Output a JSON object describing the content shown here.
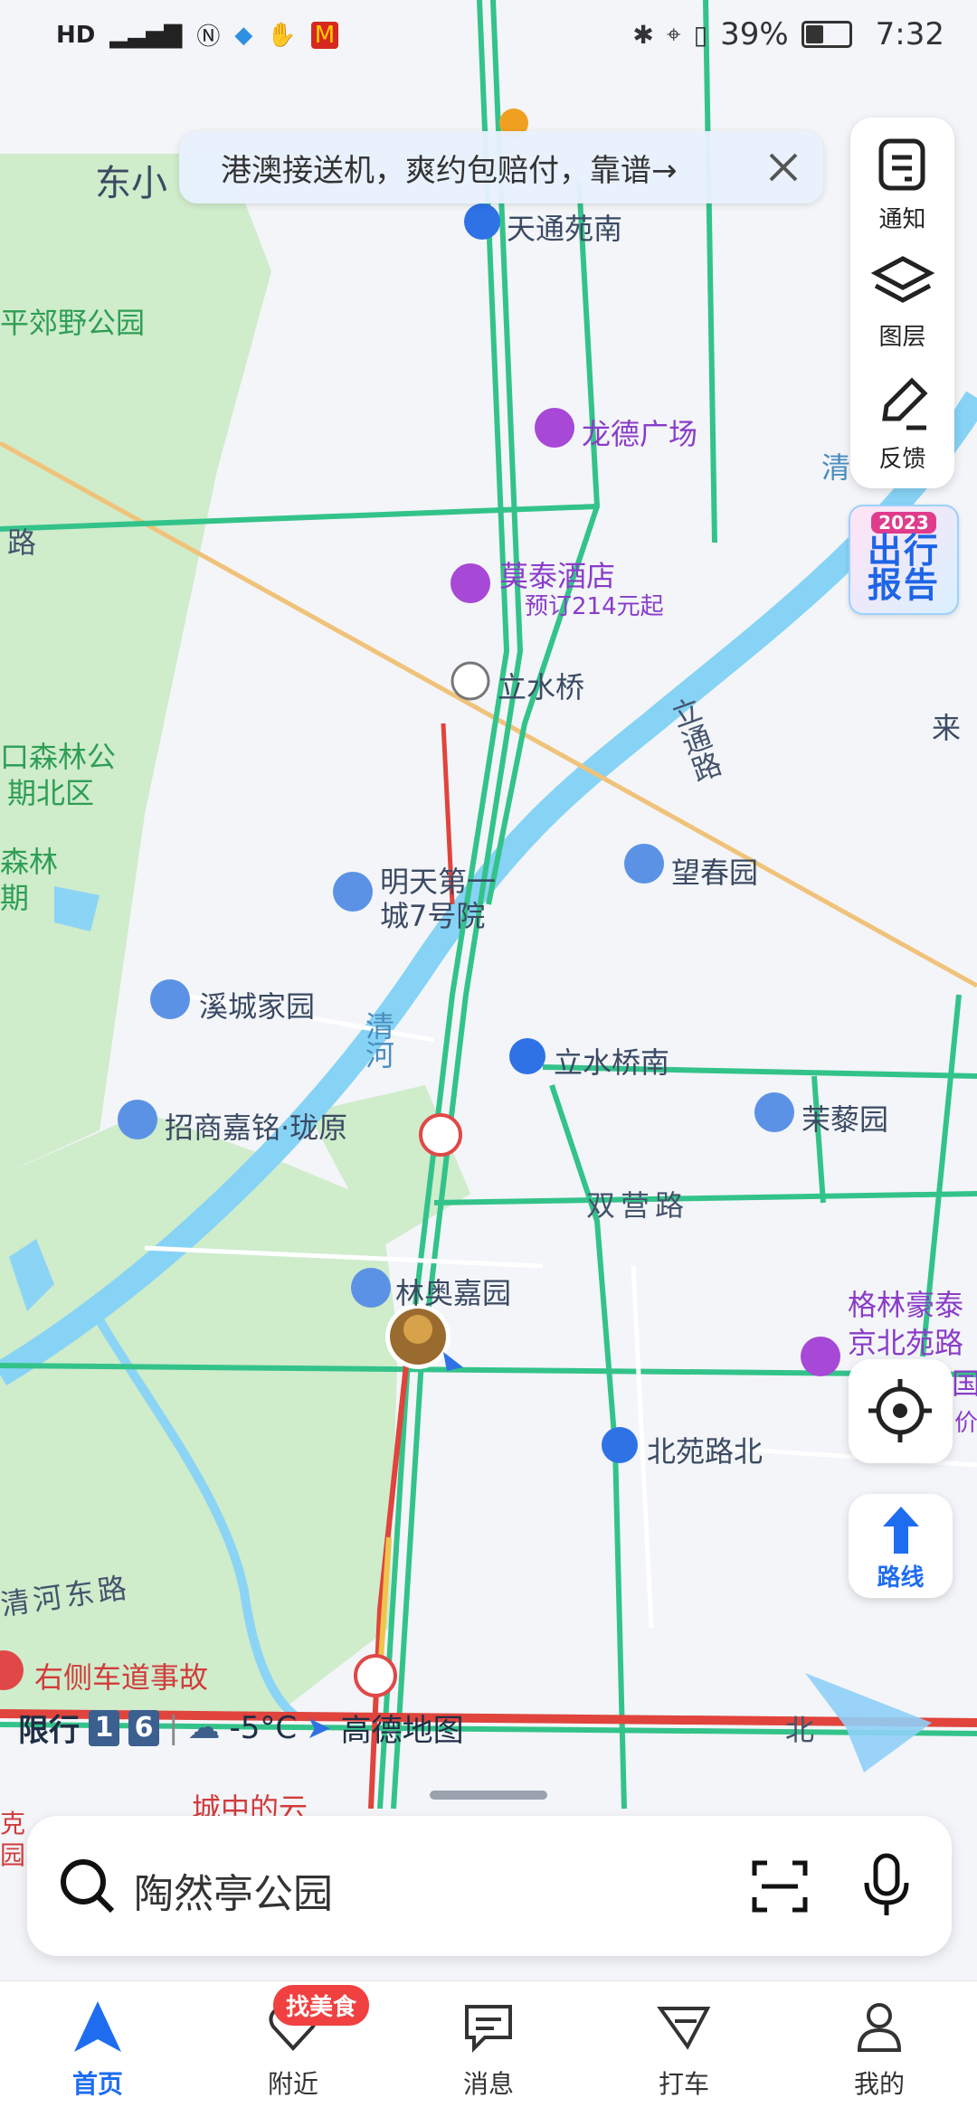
{
  "status_bar": {
    "left_icons": [
      "HD",
      "4G",
      "signal",
      "nfc",
      "app",
      "hand",
      "mcdonalds"
    ],
    "network": "HD",
    "battery_percent": "39%",
    "time": "7:32"
  },
  "banner": {
    "text": "港澳接送机，爽约包赔付，靠谱→"
  },
  "right_toolbar": {
    "notify": "通知",
    "layers": "图层",
    "feedback": "反馈"
  },
  "report_badge": {
    "year": "2023",
    "line1": "出行",
    "line2": "报告"
  },
  "map": {
    "labels": {
      "dongxiao": "东小",
      "park_left": "平郊野公园",
      "road_left": "路",
      "tiantong_nan": "天通苑南",
      "longde": "龙德广场",
      "motai": "莫泰酒店",
      "motai_price": "预订214元起",
      "lishuiqiao": "立水桥",
      "forest_park_a": "口森林公",
      "forest_park_b": "期北区",
      "forest_c": "森林",
      "forest_d": "期",
      "litong_road": "立通路",
      "wangchun": "望春园",
      "lai": "来",
      "mingtian_1": "明天第一",
      "mingtian_2": "城7号院",
      "xicheng": "溪城家园",
      "qinghe": "清河",
      "qing_top": "清",
      "lishuiqiao_nan": "立水桥南",
      "zhaoshang": "招商嘉铭·珑原",
      "moli": "茉藜园",
      "shuangying": "双营路",
      "linao": "林奥嘉园",
      "gelin_1": "格林豪泰",
      "gelin_2": "京北苑路",
      "gelin_3": "国",
      "gelin_4": "价",
      "beiyuan_bei": "北苑路北",
      "qinghe_dong": "清河东路",
      "accident": "右侧车道事故",
      "chengzhong": "城中的云",
      "bei_right": "北",
      "ke_left": "克",
      "yuan_left": "园"
    }
  },
  "controls": {
    "route": "路线"
  },
  "info_line": {
    "restriction_label": "限行",
    "plate_1": "1",
    "plate_2": "6",
    "temperature": "-5°C",
    "brand": "高德地图"
  },
  "search": {
    "placeholder": "陶然亭公园"
  },
  "bottom_nav": {
    "food_badge": "找美食",
    "items": [
      {
        "label": "首页",
        "active": true
      },
      {
        "label": "附近",
        "active": false
      },
      {
        "label": "消息",
        "active": false
      },
      {
        "label": "打车",
        "active": false
      },
      {
        "label": "我的",
        "active": false
      }
    ]
  },
  "colors": {
    "accent": "#1e6df0",
    "river": "#86d3f5",
    "park": "#cfeccb",
    "road_green": "#33c38a",
    "road_red": "#e0443c",
    "road_yellow": "#f0c34a",
    "rail": "#f0c27a"
  }
}
